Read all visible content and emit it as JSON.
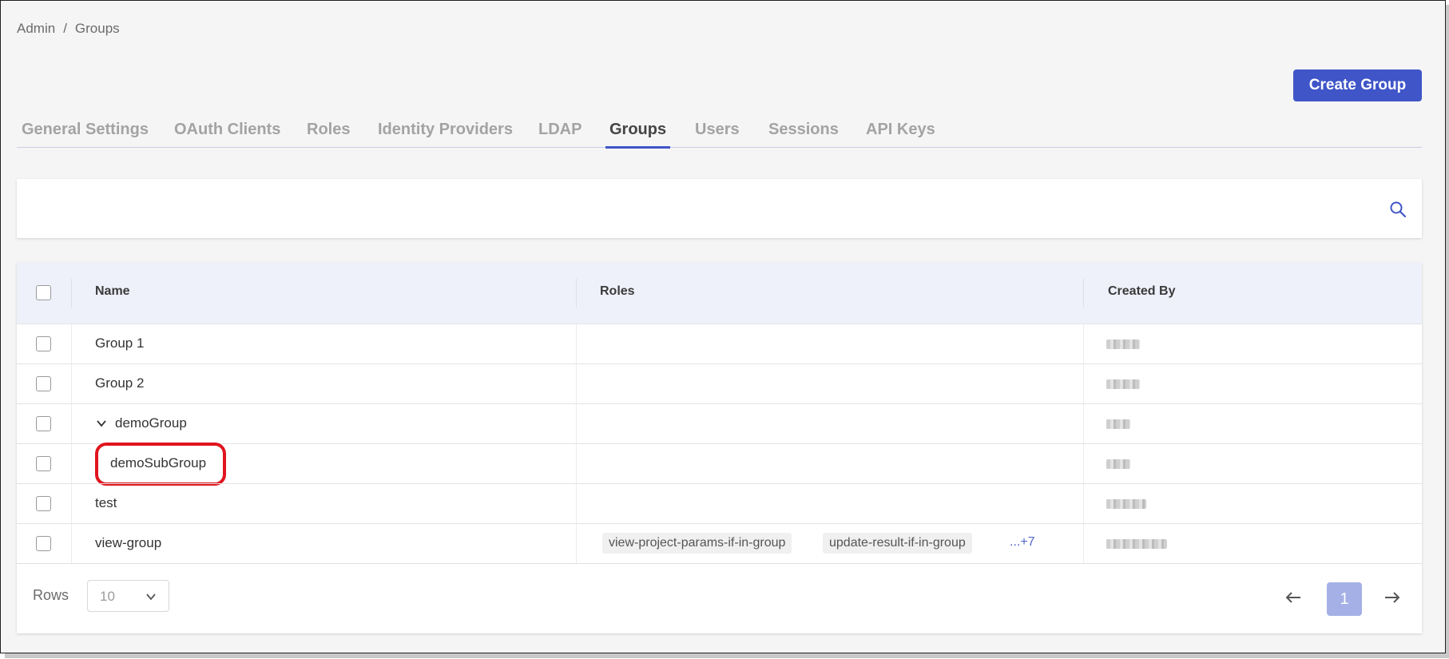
{
  "breadcrumb": {
    "root": "Admin",
    "separator": "/",
    "current": "Groups"
  },
  "header": {
    "create_button": "Create Group"
  },
  "tabs": [
    {
      "label": "General Settings",
      "active": false
    },
    {
      "label": "OAuth Clients",
      "active": false
    },
    {
      "label": "Roles",
      "active": false
    },
    {
      "label": "Identity Providers",
      "active": false
    },
    {
      "label": "LDAP",
      "active": false
    },
    {
      "label": "Groups",
      "active": true
    },
    {
      "label": "Users",
      "active": false
    },
    {
      "label": "Sessions",
      "active": false
    },
    {
      "label": "API Keys",
      "active": false
    }
  ],
  "search": {
    "placeholder": "",
    "icon": "search-icon"
  },
  "table": {
    "columns": [
      "Name",
      "Roles",
      "Created By"
    ],
    "rows": [
      {
        "name": "Group 1",
        "roles": [],
        "more": "",
        "created_by": ""
      },
      {
        "name": "Group 2",
        "roles": [],
        "more": "",
        "created_by": ""
      },
      {
        "name": "demoGroup",
        "roles": [],
        "more": "",
        "created_by": "",
        "expanded": true
      },
      {
        "name": "demoSubGroup",
        "roles": [],
        "more": "",
        "created_by": "",
        "child": true,
        "highlighted": true
      },
      {
        "name": "test",
        "roles": [],
        "more": "",
        "created_by": ""
      },
      {
        "name": "view-group",
        "roles": [
          "view-project-params-if-in-group",
          "update-result-if-in-group"
        ],
        "more": "...+7",
        "created_by": ""
      }
    ]
  },
  "pagination": {
    "rows_label": "Rows",
    "rows_value": "10",
    "current_page": "1"
  },
  "colors": {
    "accent": "#3f55c8",
    "highlight": "#e0141e",
    "page_active": "#a5b0e6"
  }
}
